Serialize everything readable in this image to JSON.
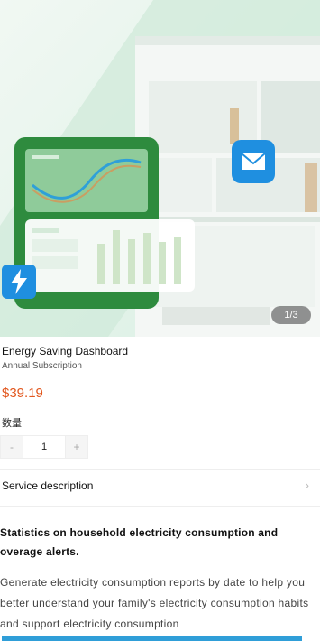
{
  "gallery": {
    "pager": "1/3",
    "accent_green": "#2e8b3e",
    "accent_blue": "#1f8fe0"
  },
  "product": {
    "title": "Energy Saving Dashboard",
    "subtitle": "Annual Subscription",
    "price": "$39.19"
  },
  "quantity": {
    "label": "数量",
    "minus": "-",
    "value": "1",
    "plus": "+"
  },
  "service": {
    "label": "Service description",
    "chevron": "›"
  },
  "description": {
    "heading": "Statistics on household electricity consumption and overage alerts.",
    "body": "Generate electricity consumption reports by date to help you better understand your family's electricity consumption habits and support electricity consumption"
  }
}
